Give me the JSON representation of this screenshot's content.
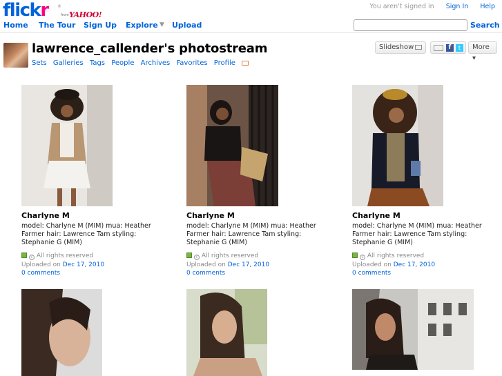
{
  "brand": {
    "logo_flick": "flick",
    "logo_r": "r",
    "reg": "®",
    "from": "from",
    "yahoo": "YAHOO!"
  },
  "topbar": {
    "signed_status": "You aren't signed in",
    "sign_in": "Sign In",
    "help": "Help"
  },
  "nav": {
    "home": "Home",
    "tour": "The Tour",
    "signup": "Sign Up",
    "explore": "Explore",
    "explore_caret": "▼",
    "upload": "Upload"
  },
  "search": {
    "value": "",
    "placeholder": "",
    "button": "Search"
  },
  "profile": {
    "title": "lawrence_callender's photostream",
    "links": [
      "Sets",
      "Galleries",
      "Tags",
      "People",
      "Archives",
      "Favorites",
      "Profile"
    ],
    "slideshow": "Slideshow",
    "more": "More ▾",
    "fb": "f",
    "tw": "t"
  },
  "photos": [
    {
      "title": "Charlyne M",
      "desc": "model: Charlyne M (MIM) mua: Heather Farmer hair: Lawrence Tam styling: Stephanie G (MIM)",
      "rights": "All rights reserved",
      "uploaded_label": "Uploaded on",
      "date": "Dec 17, 2010",
      "comments": "0 comments"
    },
    {
      "title": "Charlyne M",
      "desc": "model: Charlyne M (MIM) mua: Heather Farmer hair: Lawrence Tam styling: Stephanie G (MIM)",
      "rights": "All rights reserved",
      "uploaded_label": "Uploaded on",
      "date": "Dec 17, 2010",
      "comments": "0 comments"
    },
    {
      "title": "Charlyne M",
      "desc": "model: Charlyne M (MIM) mua: Heather Farmer hair: Lawrence Tam styling: Stephanie G (MIM)",
      "rights": "All rights reserved",
      "uploaded_label": "Uploaded on",
      "date": "Dec 17, 2010",
      "comments": "0 comments"
    }
  ],
  "colors": {
    "link": "#0063dc",
    "brand_pink": "#ff0084",
    "yahoo_red": "#cc0033"
  }
}
